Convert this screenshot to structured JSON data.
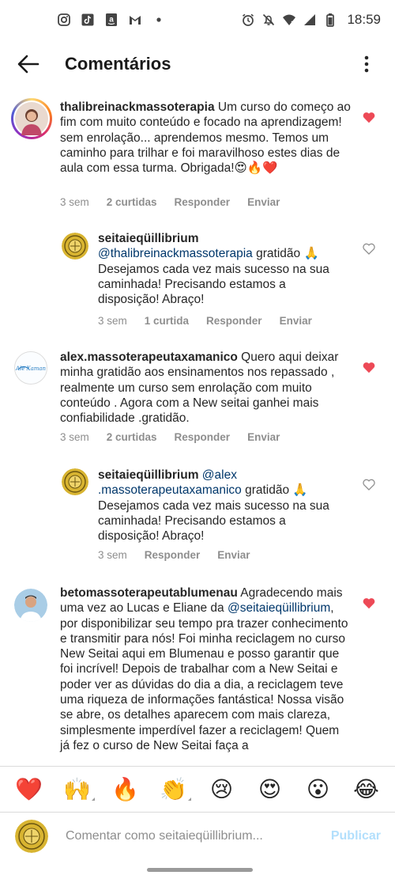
{
  "status_bar": {
    "time": "18:59",
    "left_icons": [
      "instagram-icon",
      "tiktok-icon",
      "amazon-icon",
      "gmail-icon",
      "dot-icon"
    ],
    "right_icons": [
      "alarm-icon",
      "mute-icon",
      "wifi-icon",
      "signal-icon",
      "battery-icon"
    ]
  },
  "header": {
    "title": "Comentários",
    "back_icon": "back-arrow-icon",
    "menu_icon": "more-vertical-icon"
  },
  "comments": [
    {
      "username": "thalibreinackmassoterapia",
      "text": " Um curso do começo ao fim com muito conteúdo e focado na aprendizagem!  sem enrolação... aprendemos mesmo. Temos um caminho para trilhar e foi maravilhoso estes dias de aula com essa turma. Obrigada!😍🔥❤️",
      "time": "3 sem",
      "likes": "2 curtidas",
      "reply": "Responder",
      "send": "Enviar",
      "liked": true
    },
    {
      "username": "seitaieqüillibrium",
      "mention": "@thalibreinackmassoterapia",
      "text": " gratidão 🙏 Desejamos cada vez mais sucesso na sua caminhada! Precisando estamos a disposição! Abraço!",
      "time": "3 sem",
      "likes": "1 curtida",
      "reply": "Responder",
      "send": "Enviar",
      "liked": false
    },
    {
      "username": "alex.massoterapeutaxamanico",
      "avatar_text": "Ale Xaman",
      "text": " Quero aqui deixar minha gratidão aos ensinamentos nos repassado , realmente um curso sem enrolação com muito conteúdo . Agora com a New seitai ganhei mais confiabilidade .gratidão.",
      "time": "3 sem",
      "likes": "2 curtidas",
      "reply": "Responder",
      "send": "Enviar",
      "liked": true
    },
    {
      "username": "seitaieqüillibrium",
      "mention": "@alex .massoterapeutaxamanico",
      "text": " gratidão 🙏 Desejamos cada vez mais sucesso na sua caminhada! Precisando estamos a disposição! Abraço!",
      "time": "3 sem",
      "reply": "Responder",
      "send": "Enviar",
      "liked": false
    },
    {
      "username": "betomassoterapeutablumenau",
      "text_before": " Agradecendo mais uma vez ao Lucas e Eliane da ",
      "mention": "@seitaieqüillibrium",
      "text": ", por disponibilizar seu tempo pra trazer conhecimento e transmitir para nós! Foi minha reciclagem no curso New Seitai aqui em Blumenau e posso garantir que foi incrível! Depois de trabalhar com a New Seitai e poder ver as dúvidas do dia a dia, a reciclagem teve uma riqueza de informações fantástica! Nossa visão se abre, os detalhes aparecem com mais clareza, simplesmente imperdível fazer a reciclagem! Quem já fez o curso de New Seitai faça a",
      "liked": true
    }
  ],
  "emoji_bar": [
    "❤️",
    "🙌",
    "🔥",
    "👏",
    "😢",
    "😍",
    "😮",
    "😂"
  ],
  "composer": {
    "placeholder": "Comentar como seitaieqüillibrium...",
    "post_label": "Publicar"
  },
  "colors": {
    "like_red": "#ed4956",
    "mention_blue": "#00376b",
    "meta_gray": "#8e8e8e",
    "post_disabled": "#b2dffc"
  }
}
